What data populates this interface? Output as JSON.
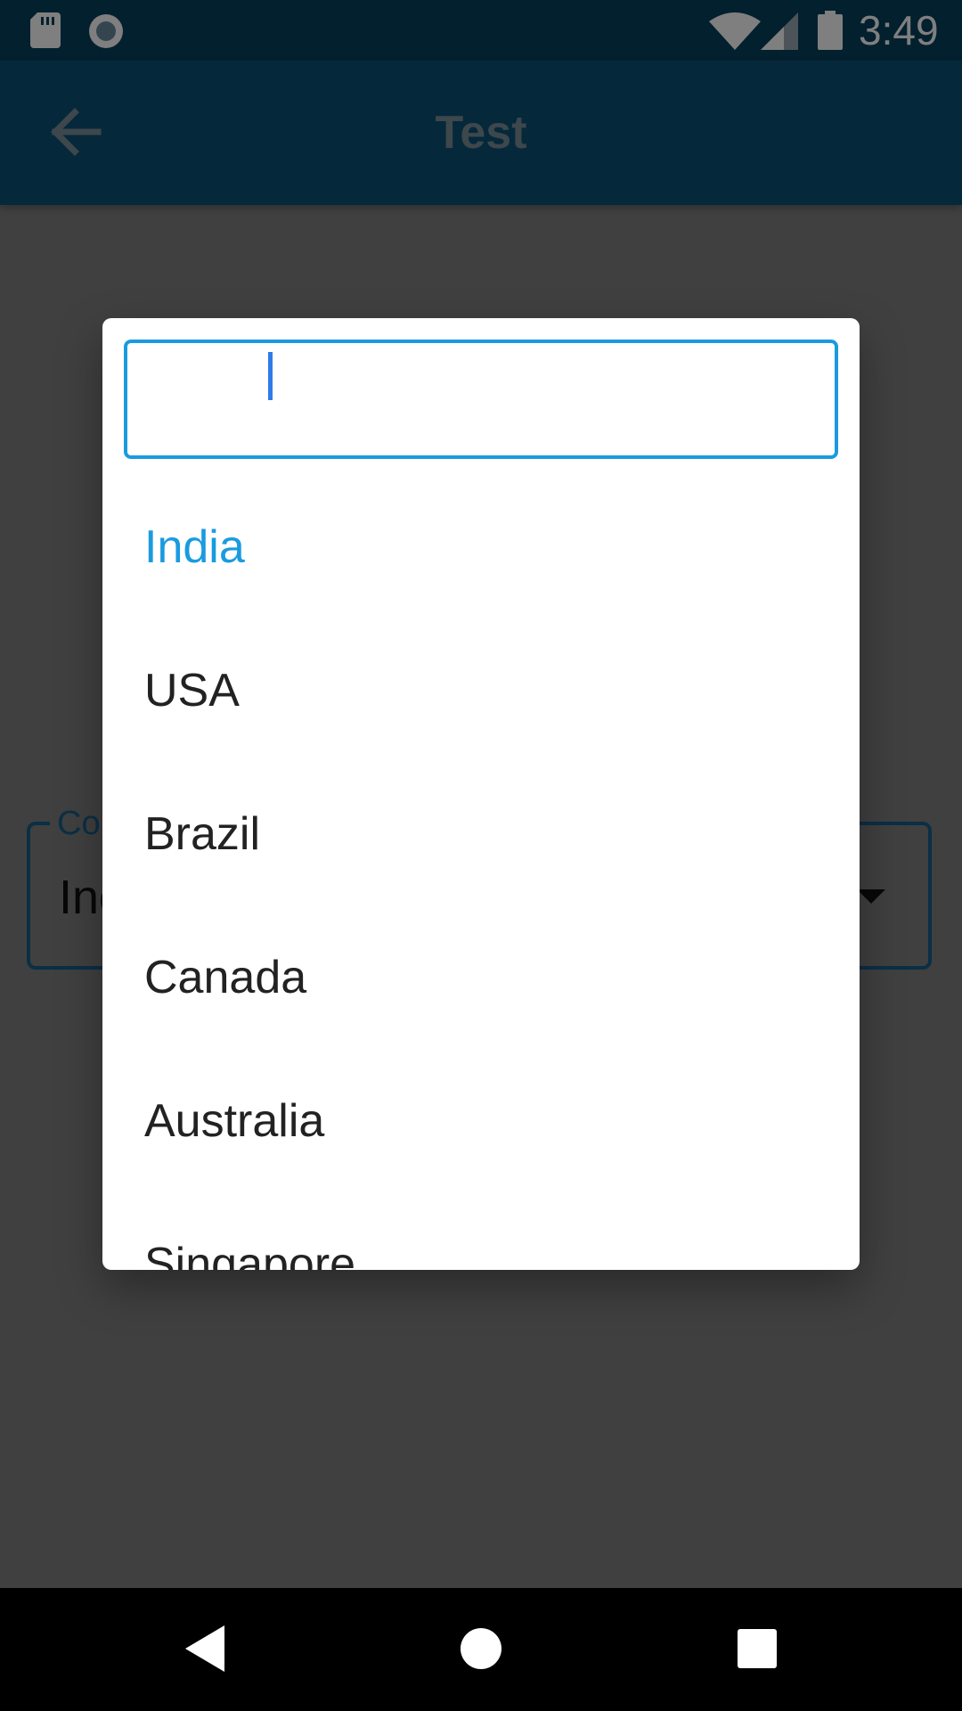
{
  "status_bar": {
    "time": "3:49",
    "icons": [
      "sd-card-icon",
      "record-icon",
      "wifi-icon",
      "signal-icon",
      "battery-icon"
    ]
  },
  "app_bar": {
    "title": "Test",
    "back_icon": "arrow-back-icon"
  },
  "background_field": {
    "label": "Co",
    "value": "Inc"
  },
  "dialog": {
    "search": {
      "value": "",
      "placeholder": ""
    },
    "options": [
      "India",
      "USA",
      "Brazil",
      "Canada",
      "Australia",
      "Singapore"
    ],
    "selected_index": 0
  },
  "nav_bar": {
    "icons": [
      "nav-back-icon",
      "nav-home-icon",
      "nav-recents-icon"
    ]
  },
  "colors": {
    "status_bar": "#07405f",
    "app_bar": "#0b5377",
    "accent": "#1a9be0",
    "scrim": "#808080"
  }
}
